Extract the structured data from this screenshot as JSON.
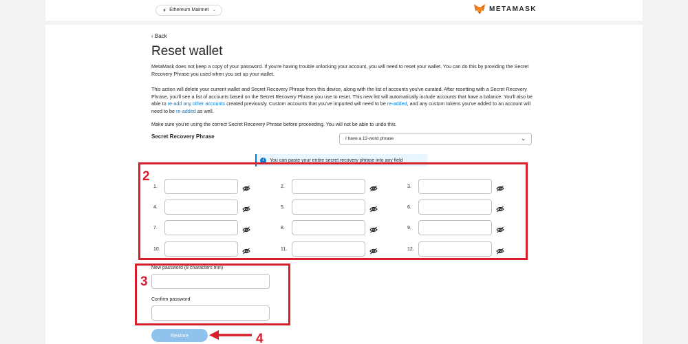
{
  "header": {
    "network_label": "Ethereum Mainnet",
    "brand": "METAMASK"
  },
  "page": {
    "back_label": "‹ Back",
    "title": "Reset wallet",
    "para1": "MetaMask does not keep a copy of your password. If you're having trouble unlocking your account, you will need to reset your wallet. You can do this by providing the Secret Recovery Phrase you used when you set up your wallet.",
    "para2_a": "This action will delete your current wallet and Secret Recovery Phrase from this device, along with the list of accounts you've curated. After resetting with a Secret Recovery Phrase, you'll see a list of accounts based on the Secret Recovery Phrase you use to reset. This new list will automatically include accounts that have a balance. You'll also be able to ",
    "para2_link1": "re-add any other accounts",
    "para2_b": " created previously. Custom accounts that you've imported will need to be ",
    "para2_link2": "re-added",
    "para2_c": ", and any custom tokens you've added to an account will need to be ",
    "para2_link3": "re-added",
    "para2_d": " as well.",
    "para3": "Make sure you're using the correct Secret Recovery Phrase before proceeding. You will not be able to undo this."
  },
  "srp": {
    "label": "Secret Recovery Phrase",
    "select_value": "I have a 12-word phrase",
    "info": "You can paste your entire secret recovery phrase into any field",
    "word_labels": [
      "1.",
      "2.",
      "3.",
      "4.",
      "5.",
      "6.",
      "7.",
      "8.",
      "9.",
      "10.",
      "11.",
      "12."
    ]
  },
  "password": {
    "new_label": "New password (8 characters min)",
    "confirm_label": "Confirm password"
  },
  "restore_label": "Restore",
  "annotations": {
    "box2_number": "2",
    "box3_number": "3",
    "arrow_number": "4",
    "color": "#d71f2b"
  }
}
